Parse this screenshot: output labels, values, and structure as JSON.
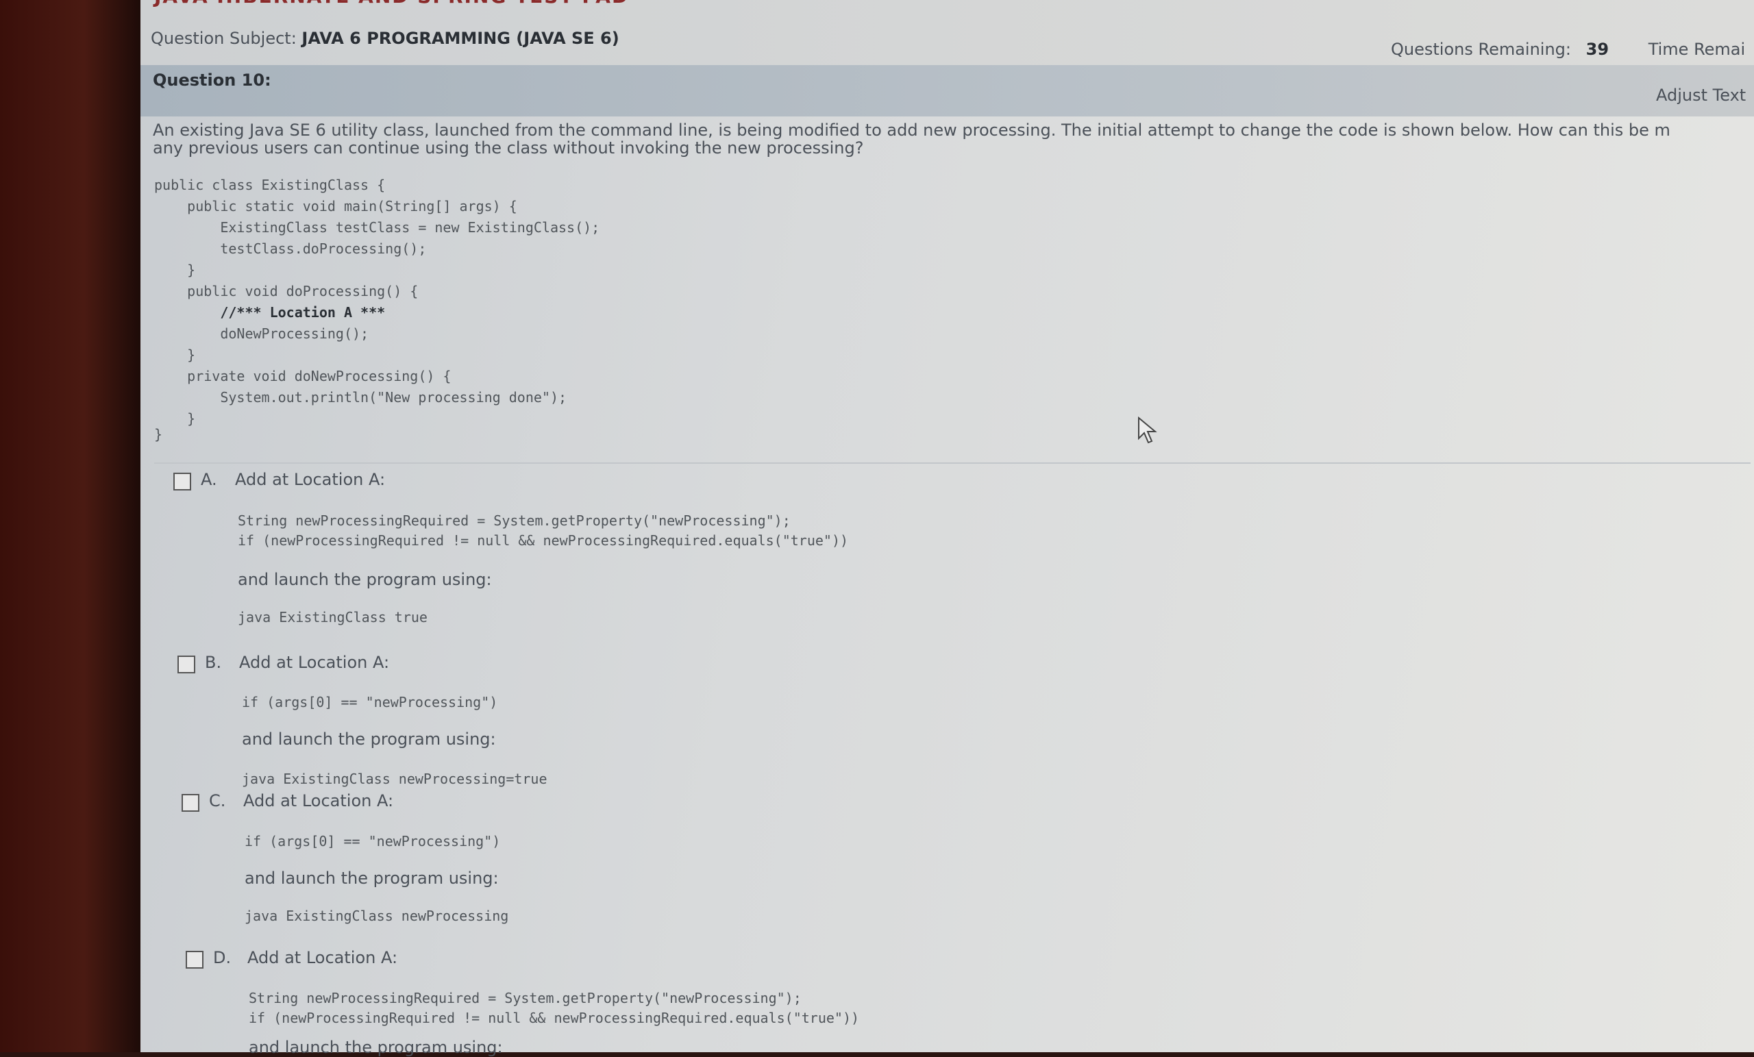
{
  "header": {
    "banner": "JAVA HIBERNATE AND SPRING TEST PAD",
    "subject_label": "Question Subject:",
    "subject": "JAVA 6 PROGRAMMING (JAVA SE 6)",
    "remaining_label": "Questions Remaining:",
    "remaining": "39",
    "time_label": "Time Remai"
  },
  "question": {
    "title": "Question 10:",
    "adjust_text": "Adjust Text",
    "text": [
      "An existing Java SE 6 utility class, launched from the command line, is being modified to add new processing. The initial attempt to change the code is shown below. How can this be m",
      "any previous users can continue using the class without invoking the new processing?"
    ],
    "code": [
      "public class ExistingClass {",
      "    public static void main(String[] args) {",
      "        ExistingClass testClass = new ExistingClass();",
      "        testClass.doProcessing();",
      "    }",
      "    public void doProcessing() {",
      "        //*** Location A ***",
      "        doNewProcessing();",
      "    }",
      "    private void doNewProcessing() {",
      "        System.out.println(\"New processing done\");",
      "    }",
      "}"
    ]
  },
  "options": [
    {
      "letter": "A.",
      "label": "Add at Location A:",
      "code": [
        "String newProcessingRequired = System.getProperty(\"newProcessing\");",
        "if (newProcessingRequired != null && newProcessingRequired.equals(\"true\"))"
      ],
      "launch": "and launch the program using:",
      "command": "java ExistingClass true"
    },
    {
      "letter": "B.",
      "label": "Add at Location A:",
      "code": [
        "if (args[0] == \"newProcessing\")"
      ],
      "launch": "and launch the program using:",
      "command": "java ExistingClass newProcessing=true"
    },
    {
      "letter": "C.",
      "label": "Add at Location A:",
      "code": [
        "if (args[0] == \"newProcessing\")"
      ],
      "launch": "and launch the program using:",
      "command": "java ExistingClass newProcessing"
    },
    {
      "letter": "D.",
      "label": "Add at Location A:",
      "code": [
        "String newProcessingRequired = System.getProperty(\"newProcessing\");",
        "if (newProcessingRequired != null && newProcessingRequired.equals(\"true\"))"
      ],
      "launch": "and launch the program using:"
    }
  ]
}
